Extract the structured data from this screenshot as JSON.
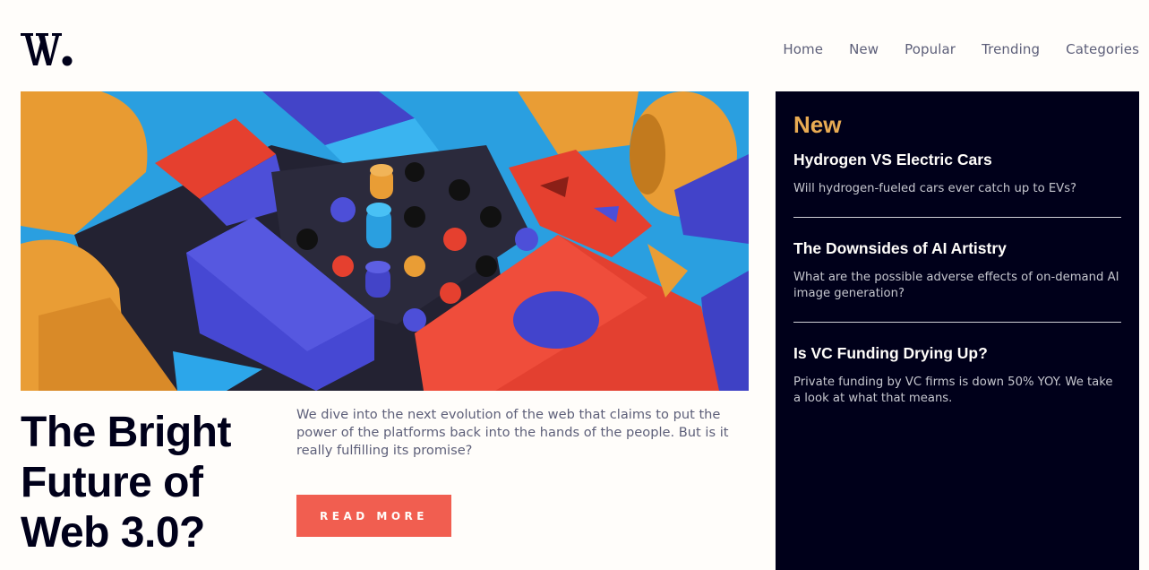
{
  "brand": {
    "logo_icon": "w-logo-icon"
  },
  "nav": {
    "items": [
      "Home",
      "New",
      "Popular",
      "Trending",
      "Categories"
    ]
  },
  "hero": {
    "image_icon": "abstract-3d-blocks-illustration"
  },
  "main": {
    "headline_lines": [
      "The Bright",
      "Future of",
      "Web 3.0?"
    ],
    "description": "We dive into the next evolution of the web that claims to put the power of the platforms back into the hands of the people. But is it really fulfilling its promise?",
    "button_label": "Read more"
  },
  "sidebar": {
    "title": "New",
    "items": [
      {
        "title": "Hydrogen VS Electric Cars",
        "desc": "Will hydrogen-fueled cars ever catch up to EVs?"
      },
      {
        "title": "The Downsides of AI Artistry",
        "desc": "What are the possible adverse effects of on-demand AI image generation?"
      },
      {
        "title": "Is VC Funding Drying Up?",
        "desc": "Private funding by VC firms is down 50% YOY. We take a look at what that means."
      }
    ]
  },
  "colors": {
    "background": "#fffdfa",
    "dark": "#00001a",
    "accent_orange": "#e9ab53",
    "accent_red": "#f15e50",
    "text_grey": "#5d5f79"
  }
}
